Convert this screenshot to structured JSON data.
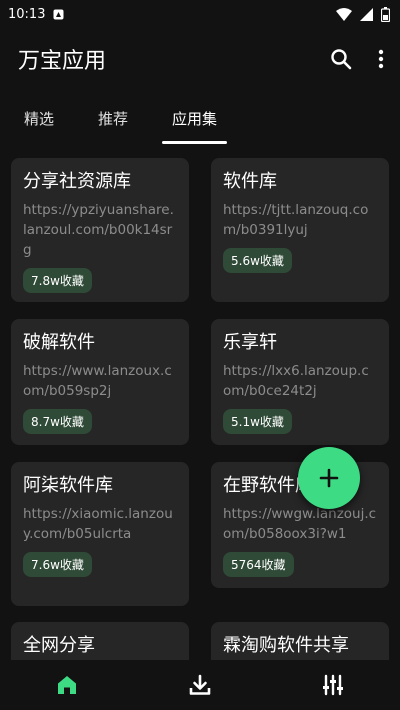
{
  "status_bar": {
    "time": "10:13"
  },
  "app_bar": {
    "title": "万宝应用"
  },
  "tabs": [
    {
      "label": "精选",
      "active": false
    },
    {
      "label": "推荐",
      "active": false
    },
    {
      "label": "应用集",
      "active": true
    }
  ],
  "cards": [
    {
      "title": "分享社资源库",
      "url": "https://ypziyuanshare.lanzoul.com/b00k14srg",
      "count": "7.8w收藏"
    },
    {
      "title": "软件库",
      "url": "https://tjtt.lanzouq.com/b0391lyuj",
      "count": "5.6w收藏"
    },
    {
      "title": "破解软件",
      "url": "https://www.lanzoux.com/b059sp2j",
      "count": "8.7w收藏"
    },
    {
      "title": "乐享轩",
      "url": "https://lxx6.lanzoup.com/b0ce24t2j",
      "count": "5.1w收藏"
    },
    {
      "title": "阿柒软件库",
      "url": "https://xiaomic.lanzouy.com/b05ulcrta",
      "count": "7.6w收藏"
    },
    {
      "title": "在野软件库",
      "url": "https://wwgw.lanzouj.com/b058oox3i?w1",
      "count": "5764收藏"
    },
    {
      "title": "全网分享",
      "url": "",
      "count": ""
    },
    {
      "title": "霖淘购软件共享",
      "url": "",
      "count": ""
    }
  ],
  "colors": {
    "accent": "#3ddc84",
    "background": "#121212",
    "card": "#262626",
    "badge": "#2f4a36"
  },
  "icons": {
    "search": "search-icon",
    "more": "more-vert-icon",
    "fab": "plus-icon",
    "nav_home": "home-icon",
    "nav_download": "download-icon",
    "nav_settings": "sliders-icon"
  }
}
